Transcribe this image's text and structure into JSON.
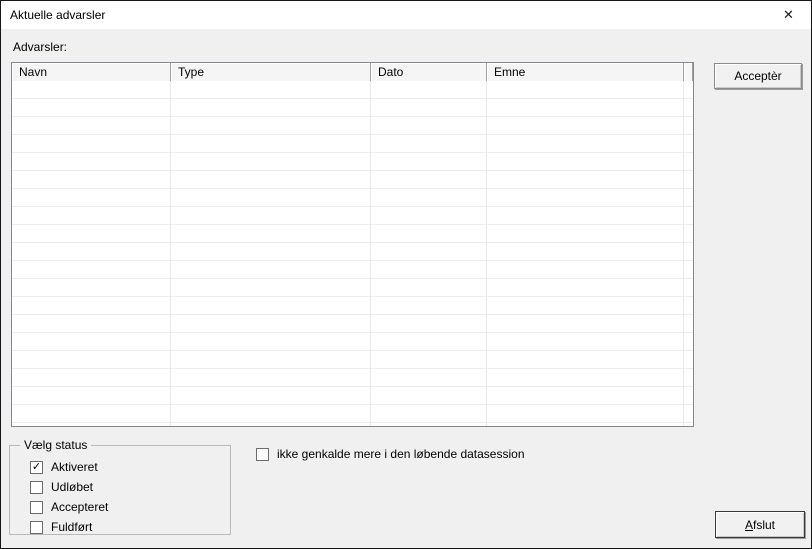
{
  "window": {
    "title": "Aktuelle advarsler",
    "close_glyph": "✕"
  },
  "main": {
    "warnings_label": "Advarsler:",
    "accept_button": "Acceptèr",
    "table": {
      "columns": [
        "Navn",
        "Type",
        "Dato",
        "Emne"
      ],
      "rows": []
    }
  },
  "status_group": {
    "title": "Vælg status",
    "options": [
      {
        "label": "Aktiveret",
        "checked": true
      },
      {
        "label": "Udløbet",
        "checked": false
      },
      {
        "label": "Accepteret",
        "checked": false
      },
      {
        "label": "Fuldført",
        "checked": false
      }
    ],
    "check_glyph": "✓"
  },
  "session_checkbox": {
    "label": "ikke genkalde mere i den løbende datasession",
    "checked": false
  },
  "exit_button": {
    "accesskey": "A",
    "rest": "fslut"
  }
}
